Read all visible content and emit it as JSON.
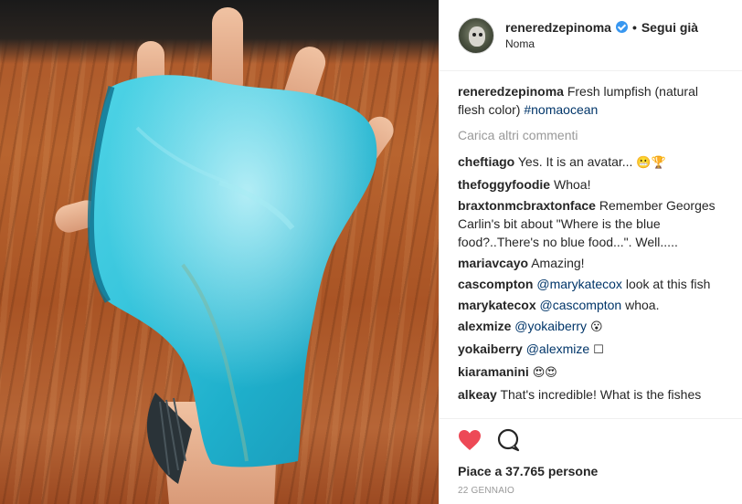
{
  "header": {
    "username": "reneredzepinoma",
    "separator": "•",
    "follow_label": "Segui già",
    "location": "Noma"
  },
  "caption": {
    "username": "reneredzepinoma",
    "text": "Fresh lumpfish (natural flesh color)",
    "hashtag": "#nomaocean"
  },
  "load_more_label": "Carica altri commenti",
  "comments": [
    {
      "user": "cheftiago",
      "text": "Yes. It is an avatar...",
      "mention": "",
      "after": "",
      "emoji": "😬🏆"
    },
    {
      "user": "thefoggyfoodie",
      "text": "Whoa!",
      "mention": "",
      "after": "",
      "emoji": ""
    },
    {
      "user": "braxtonmcbraxtonface",
      "text": "Remember Georges Carlin's bit about \"Where is the blue food?..There's no blue food...\". Well.....",
      "mention": "",
      "after": "",
      "emoji": ""
    },
    {
      "user": "mariavcayo",
      "text": "Amazing!",
      "mention": "",
      "after": "",
      "emoji": ""
    },
    {
      "user": "cascompton",
      "text": "",
      "mention": "@marykatecox",
      "after": "look at this fish",
      "emoji": ""
    },
    {
      "user": "marykatecox",
      "text": "",
      "mention": "@cascompton",
      "after": "whoa.",
      "emoji": ""
    },
    {
      "user": "alexmize",
      "text": "",
      "mention": "@yokaiberry",
      "after": "",
      "emoji": "😮"
    },
    {
      "user": "yokaiberry",
      "text": "",
      "mention": "@alexmize",
      "after": "",
      "emoji": "☐"
    },
    {
      "user": "kiaramanini",
      "text": "",
      "mention": "",
      "after": "",
      "emoji": "😍😍"
    },
    {
      "user": "alkeay",
      "text": "That's incredible! What is the fishes diet? Or what makes the flesh that color?",
      "mention": "",
      "after": "",
      "emoji": ""
    }
  ],
  "actions": {
    "like_icon": "heart-filled-icon",
    "comment_icon": "speech-bubble-icon",
    "likes_text": "Piace a 37.765 persone",
    "date": "22 GENNAIO"
  },
  "colors": {
    "heart": "#ed4956",
    "link": "#003569",
    "verified": "#3897f0",
    "muted": "#999999"
  }
}
